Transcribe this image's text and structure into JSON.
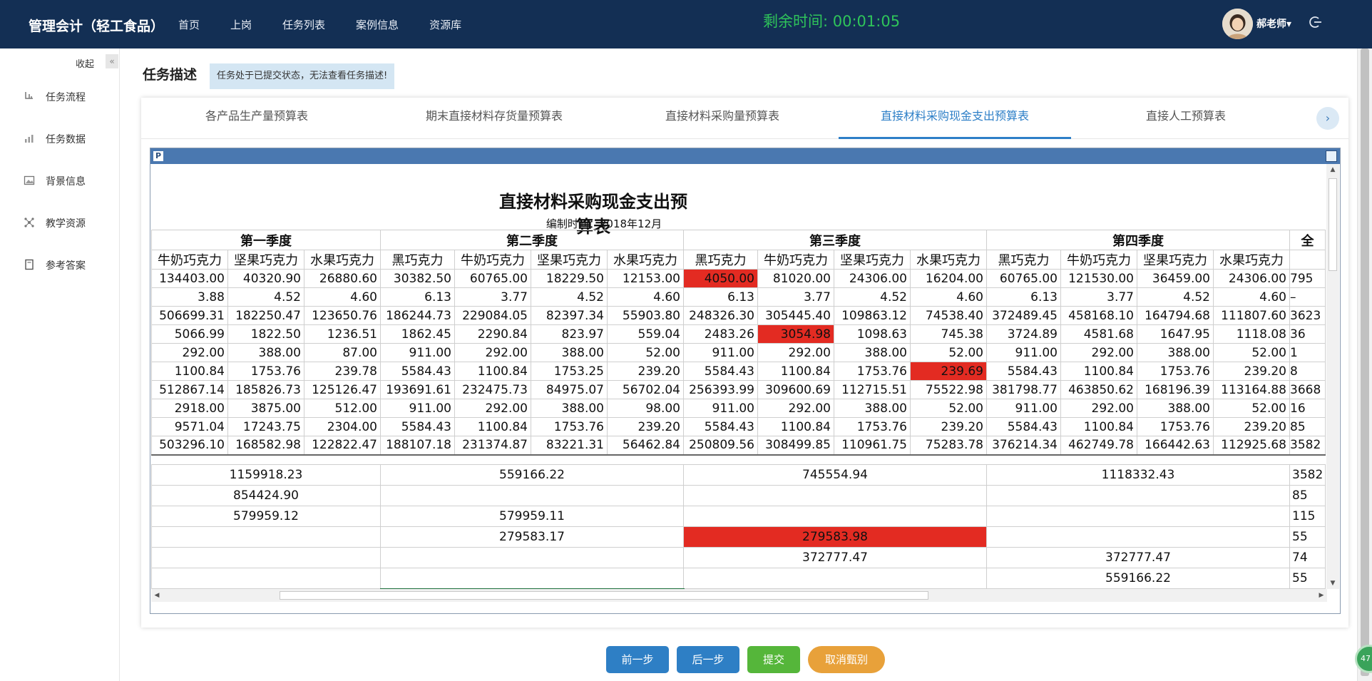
{
  "header": {
    "brand": "管理会计（轻工食品）",
    "nav": [
      "首页",
      "上岗",
      "任务列表",
      "案例信息",
      "资源库"
    ],
    "timer": "剩余时间: 00:01:05",
    "user": "郝老师▾"
  },
  "sidebar": {
    "collapse_label": "收起",
    "collapse_icon": "«",
    "items": [
      {
        "label": "任务流程",
        "icon": "flow-icon"
      },
      {
        "label": "任务数据",
        "icon": "chart-icon"
      },
      {
        "label": "背景信息",
        "icon": "image-icon"
      },
      {
        "label": "教学资源",
        "icon": "network-icon"
      },
      {
        "label": "参考答案",
        "icon": "document-icon"
      }
    ]
  },
  "task": {
    "title": "任务描述",
    "note": "任务处于已提交状态，无法查看任务描述!"
  },
  "tabs": [
    "各产品生产量预算表",
    "期末直接材料存货量预算表",
    "直接材料采购量预算表",
    "直接材料采购现金支出预算表",
    "直接人工预算表"
  ],
  "active_tab": 3,
  "sheet": {
    "title": "直接材料采购现金支出预算表",
    "subtitle": "编制时间：2018年12月",
    "quarters": [
      "第一季度",
      "第二季度",
      "第三季度",
      "第四季度",
      "全"
    ],
    "products": {
      "q1": [
        "牛奶巧克力",
        "坚果巧克力",
        "水果巧克力"
      ],
      "q": [
        "黑巧克力",
        "牛奶巧克力",
        "坚果巧克力",
        "水果巧克力"
      ]
    },
    "rows": [
      [
        "134403.00",
        "40320.90",
        "26880.60",
        "30382.50",
        "60765.00",
        "18229.50",
        "12153.00",
        "4050.00",
        "81020.00",
        "24306.00",
        "16204.00",
        "60765.00",
        "121530.00",
        "36459.00",
        "24306.00",
        "795"
      ],
      [
        "3.88",
        "4.52",
        "4.60",
        "6.13",
        "3.77",
        "4.52",
        "4.60",
        "6.13",
        "3.77",
        "4.52",
        "4.60",
        "6.13",
        "3.77",
        "4.52",
        "4.60",
        "–"
      ],
      [
        "506699.31",
        "182250.47",
        "123650.76",
        "186244.73",
        "229084.05",
        "82397.34",
        "55903.80",
        "248326.30",
        "305445.40",
        "109863.12",
        "74538.40",
        "372489.45",
        "458168.10",
        "164794.68",
        "111807.60",
        "3623"
      ],
      [
        "5066.99",
        "1822.50",
        "1236.51",
        "1862.45",
        "2290.84",
        "823.97",
        "559.04",
        "2483.26",
        "3054.98",
        "1098.63",
        "745.38",
        "3724.89",
        "4581.68",
        "1647.95",
        "1118.08",
        "36"
      ],
      [
        "292.00",
        "388.00",
        "87.00",
        "911.00",
        "292.00",
        "388.00",
        "52.00",
        "911.00",
        "292.00",
        "388.00",
        "52.00",
        "911.00",
        "292.00",
        "388.00",
        "52.00",
        "1"
      ],
      [
        "1100.84",
        "1753.76",
        "239.78",
        "5584.43",
        "1100.84",
        "1753.25",
        "239.20",
        "5584.43",
        "1100.84",
        "1753.76",
        "239.69",
        "5584.43",
        "1100.84",
        "1753.76",
        "239.20",
        "8"
      ],
      [
        "512867.14",
        "185826.73",
        "125126.47",
        "193691.61",
        "232475.73",
        "84975.07",
        "56702.04",
        "256393.99",
        "309600.69",
        "112715.51",
        "75522.98",
        "381798.77",
        "463850.62",
        "168196.39",
        "113164.88",
        "3668"
      ],
      [
        "2918.00",
        "3875.00",
        "512.00",
        "911.00",
        "292.00",
        "388.00",
        "98.00",
        "911.00",
        "292.00",
        "388.00",
        "52.00",
        "911.00",
        "292.00",
        "388.00",
        "52.00",
        "16"
      ],
      [
        "9571.04",
        "17243.75",
        "2304.00",
        "5584.43",
        "1100.84",
        "1753.76",
        "239.20",
        "5584.43",
        "1100.84",
        "1753.76",
        "239.20",
        "5584.43",
        "1100.84",
        "1753.76",
        "239.20",
        "85"
      ],
      [
        "503296.10",
        "168582.98",
        "122822.47",
        "188107.18",
        "231374.87",
        "83221.31",
        "56462.84",
        "250809.56",
        "308499.85",
        "110961.75",
        "75283.78",
        "376214.34",
        "462749.78",
        "166442.63",
        "112925.68",
        "3582"
      ]
    ],
    "red_cells": [
      [
        0,
        7
      ],
      [
        3,
        8
      ],
      [
        5,
        10
      ]
    ],
    "summary": [
      [
        "1159918.23",
        "559166.22",
        "745554.94",
        "1118332.43",
        "3582"
      ],
      [
        "854424.90",
        "",
        "",
        "",
        "85"
      ],
      [
        "579959.12",
        "579959.11",
        "",
        "",
        "115"
      ],
      [
        "",
        "279583.17",
        "279583.98",
        "",
        "55"
      ],
      [
        "",
        "",
        "372777.47",
        "372777.47",
        "74"
      ],
      [
        "",
        "",
        "",
        "559166.22",
        "55"
      ],
      [
        "",
        "",
        "",
        "",
        ""
      ]
    ],
    "summary_red": [
      [
        3,
        2
      ]
    ],
    "summary_selected": [
      [
        6,
        1
      ]
    ]
  },
  "buttons": {
    "prev": "前一步",
    "next": "后一步",
    "submit": "提交",
    "cancel": "取消甄别"
  },
  "colors": {
    "topbar": "#132f54",
    "timer": "#2fc45a",
    "accent": "#2d7fc7",
    "error": "#e32b22"
  }
}
